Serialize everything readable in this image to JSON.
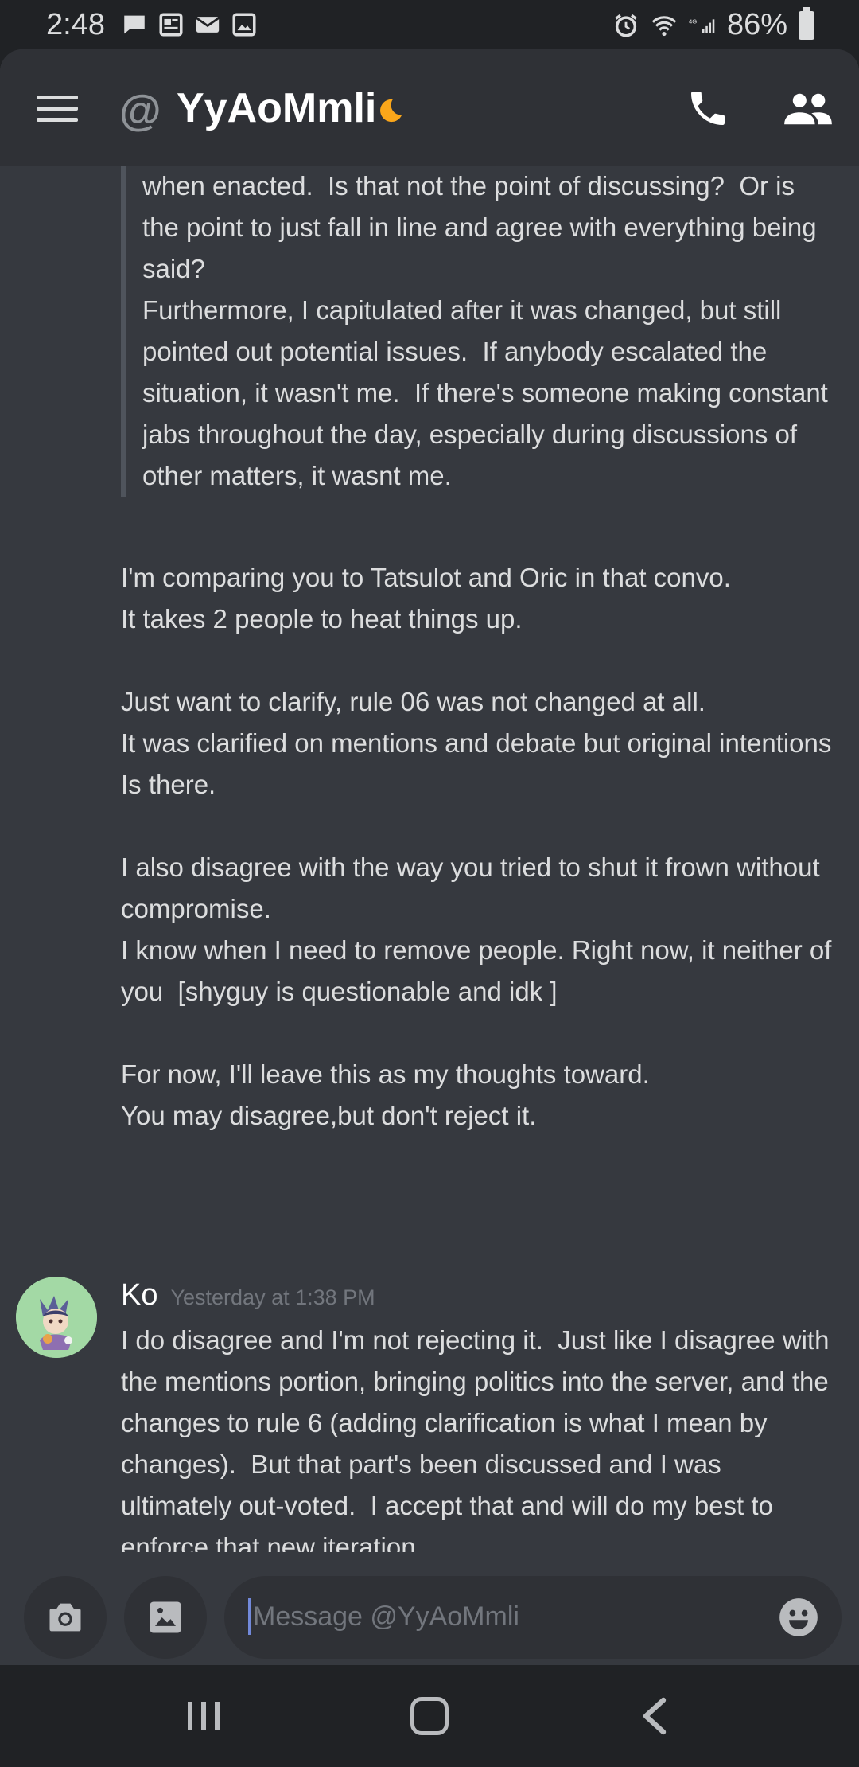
{
  "status_bar": {
    "time": "2:48",
    "battery": "86%",
    "network": "4G"
  },
  "header": {
    "at_symbol": "@",
    "channel_name": "YyAoMmli"
  },
  "messages": {
    "quote_lines": [
      "when enacted.  Is that not the point of discussing?  Or is the point to just fall in line and agree with everything being said?",
      "",
      "Furthermore, I capitulated after it was changed, but still pointed out potential issues.  If anybody escalated the situation, it wasn't me.  If there's someone making constant jabs throughout the day, especially during discussions of other matters, it wasnt me."
    ],
    "reply_block_1": "I'm comparing you to Tatsulot and Oric in that convo.\nIt takes 2 people to heat things up.\n\nJust want to clarify, rule 06 was not changed at all.\nIt was clarified on mentions and debate but original intentions Is there.\n\nI also disagree with the way you tried to shut it frown without compromise.\nI know when I need to remove people. Right now, it neither of you  [shyguy is questionable and idk ]\n\nFor now, I'll leave this as my thoughts toward.\nYou may disagree,but don't reject it.",
    "ko_message": {
      "author": "Ko",
      "timestamp": "Yesterday at 1:38 PM",
      "text": "I do disagree and I'm not rejecting it.  Just like I disagree with the mentions portion, bringing politics into the server, and the changes to rule 6 (adding clarification is what I mean by changes).  But that part's been discussed and I was ultimately out-voted.  I accept that and will do my best to enforce that new iteration.\n\nBringing up opposition isnt shutting down, it's opposition."
    }
  },
  "composer": {
    "placeholder": "Message @YyAoMmli"
  },
  "colors": {
    "background": "#36393f",
    "header": "#2f3136",
    "status_bar": "#202225",
    "text": "#dcddde",
    "muted": "#72767d",
    "accent": "#7289da",
    "moon": "#faa61a"
  },
  "icons": [
    "message-icon",
    "news-icon",
    "mail-icon",
    "image-icon",
    "alarm-icon",
    "wifi-icon",
    "signal-icon",
    "battery-icon",
    "menu-icon",
    "moon-icon",
    "phone-icon",
    "members-icon",
    "camera-icon",
    "gallery-icon",
    "emoji-icon",
    "recent-apps-icon",
    "home-icon",
    "back-icon"
  ]
}
